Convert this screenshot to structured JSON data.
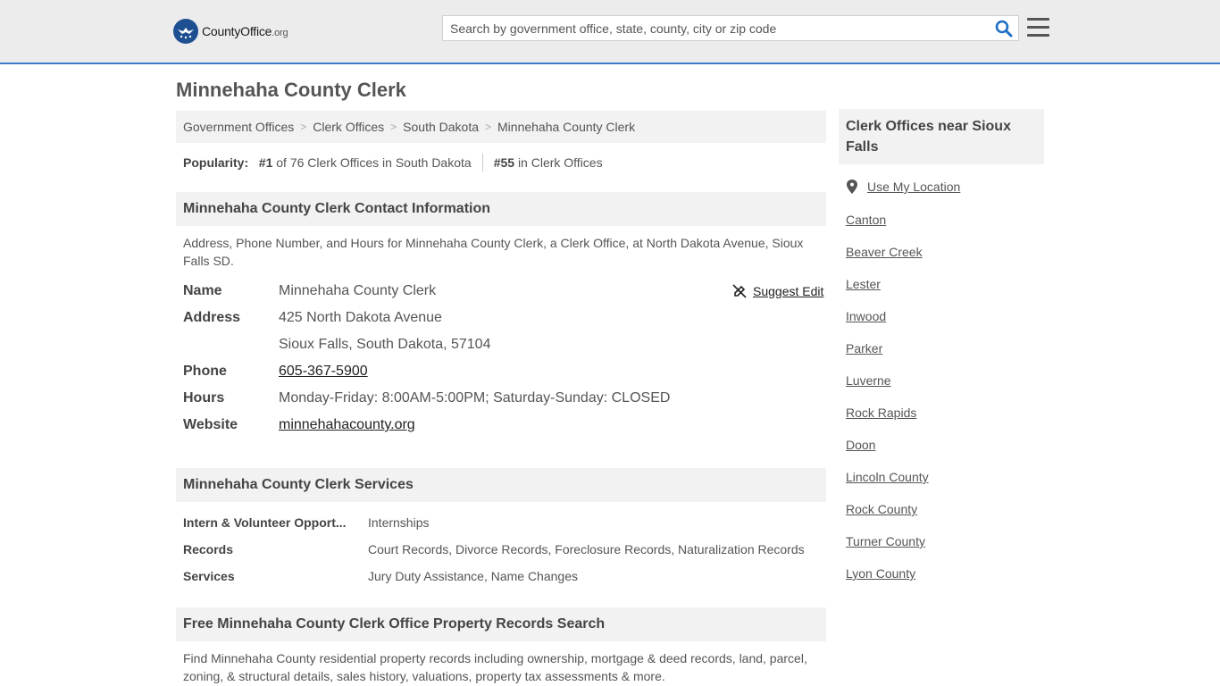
{
  "header": {
    "logo_text_main": "CountyOffice",
    "logo_text_tld": ".org",
    "search_placeholder": "Search by government office, state, county, city or zip code"
  },
  "page_title": "Minnehaha County Clerk",
  "breadcrumb": [
    "Government Offices",
    "Clerk Offices",
    "South Dakota",
    "Minnehaha County Clerk"
  ],
  "popularity": {
    "label": "Popularity:",
    "rank1": "#1",
    "rank1_text": "of 76 Clerk Offices in South Dakota",
    "rank2": "#55",
    "rank2_text": "in Clerk Offices"
  },
  "contact": {
    "heading": "Minnehaha County Clerk Contact Information",
    "description": "Address, Phone Number, and Hours for Minnehaha County Clerk, a Clerk Office, at North Dakota Avenue, Sioux Falls SD.",
    "suggest_edit": "Suggest Edit",
    "name_label": "Name",
    "name": "Minnehaha County Clerk",
    "address_label": "Address",
    "address_line1": "425 North Dakota Avenue",
    "address_line2": "Sioux Falls, South Dakota, 57104",
    "phone_label": "Phone",
    "phone": "605-367-5900",
    "hours_label": "Hours",
    "hours": "Monday-Friday: 8:00AM-5:00PM; Saturday-Sunday: CLOSED",
    "website_label": "Website",
    "website": "minnehahacounty.org"
  },
  "services": {
    "heading": "Minnehaha County Clerk Services",
    "rows": [
      {
        "label": "Intern & Volunteer Opport...",
        "value": "Internships"
      },
      {
        "label": "Records",
        "value": "Court Records, Divorce Records, Foreclosure Records, Naturalization Records"
      },
      {
        "label": "Services",
        "value": "Jury Duty Assistance, Name Changes"
      }
    ]
  },
  "property": {
    "heading": "Free Minnehaha County Clerk Office Property Records Search",
    "description": "Find Minnehaha County residential property records including ownership, mortgage & deed records, land, parcel, zoning, & structural details, sales history, valuations, property tax assessments & more."
  },
  "sidebar": {
    "heading": "Clerk Offices near Sioux Falls",
    "use_location": "Use My Location",
    "links": [
      "Canton",
      "Beaver Creek",
      "Lester",
      "Inwood",
      "Parker",
      "Luverne",
      "Rock Rapids",
      "Doon",
      "Lincoln County",
      "Rock County",
      "Turner County",
      "Lyon County"
    ]
  },
  "colors": {
    "accent": "#3a7bc8",
    "logo_blue": "#1d4f91",
    "search_icon": "#1d6fc4"
  }
}
